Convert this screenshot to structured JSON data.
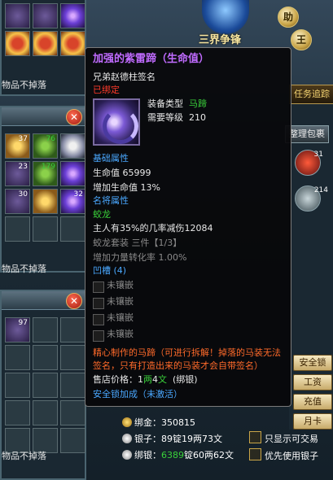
{
  "colors": {
    "purple": "#c06bff",
    "red": "#ff3a2a",
    "blue": "#4aa8ff",
    "green": "#3ad03a",
    "gray": "#8a8a8a",
    "orange": "#ff6a2a"
  },
  "left_panels": [
    {
      "footer": "物品不掉落",
      "cells": [
        "box-gift",
        "box-gift",
        "box-gift"
      ]
    },
    {
      "footer": "物品不掉落",
      "counts": [
        "37",
        "76",
        "",
        "23",
        "179",
        "",
        "30",
        "",
        "32"
      ]
    },
    {
      "footer": "物品不掉落",
      "counts": [
        "97"
      ]
    }
  ],
  "top": {
    "banner": "三界争锋",
    "help_btn": "助",
    "king_btn": "王",
    "task_track": "任务追踪"
  },
  "bag": {
    "title": "整理包裹",
    "right_counts": [
      "31",
      "214"
    ]
  },
  "right_buttons": [
    "安全锁",
    "工资",
    "充值",
    "月卡"
  ],
  "tooltip": {
    "name": "加强的紫雷蹄（生命值）",
    "signature": "兄弟赵德柱签名",
    "bound": "已绑定",
    "equip_type_label": "装备类型",
    "equip_type_value": "马蹄",
    "level_label": "需要等级",
    "level_value": "210",
    "base_title": "基础属性",
    "hp_line": "生命值 65999",
    "hp_up_line": "增加生命值 13%",
    "famous_title": "名将属性",
    "famous_name": "蛟龙",
    "famous_desc": "主人有35%的几率减伤12084",
    "set_line": "蛟龙套装 三件【1/3】",
    "set_extra": "增加力量转化率 1.00%",
    "slot_title": "凹槽 (4)",
    "sockets": [
      "未镶嵌",
      "未镶嵌",
      "未镶嵌",
      "未镶嵌"
    ],
    "desc": "精心制作的马蹄（可进行拆解！掉落的马装无法签名，只有打造出来的马装才会自带签名）",
    "price_label": "售店价格：",
    "price_num": "1",
    "price_unit1": "两",
    "price_num2": "4",
    "price_unit2": "文",
    "price_suffix": "(绑银)",
    "lock_line": "安全锁加成（未激活）"
  },
  "money": {
    "bind_gold_label": "绑金：",
    "bind_gold": "350815",
    "silver_label": "银子：",
    "silver": "89锭19两73文",
    "bind_silver_label": "绑银：",
    "bind_silver_num": "6389",
    "bind_silver_rest": "锭60两62文"
  },
  "checkboxes": {
    "tradable": "只显示可交易",
    "prefer_silver": "优先使用银子"
  }
}
